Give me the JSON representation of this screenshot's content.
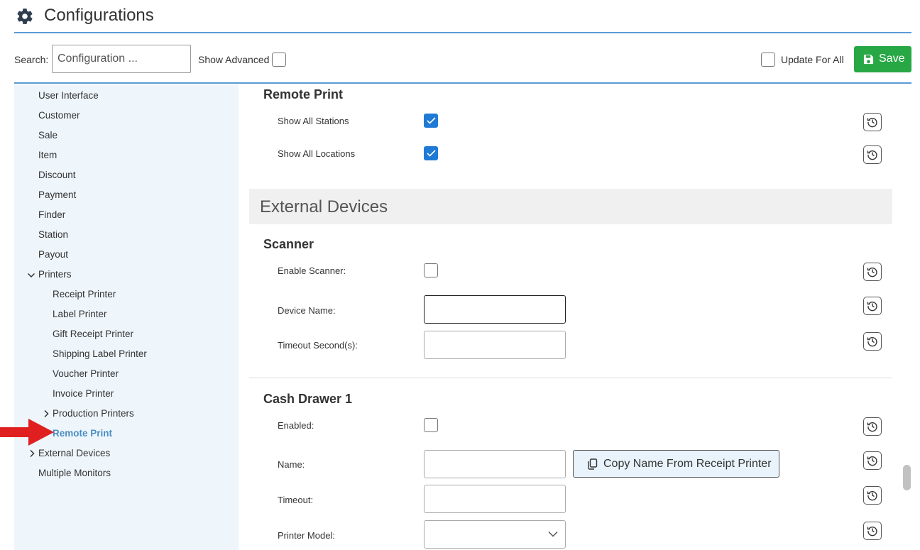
{
  "header": {
    "title": "Configurations",
    "icon": "gear-icon"
  },
  "toolbar": {
    "search_label": "Search:",
    "search_placeholder": "Configuration ...",
    "show_advanced_label": "Show Advanced",
    "update_for_all_label": "Update For All",
    "save_label": "Save"
  },
  "sidebar": {
    "items": [
      {
        "label": "User Interface"
      },
      {
        "label": "Customer"
      },
      {
        "label": "Sale"
      },
      {
        "label": "Item"
      },
      {
        "label": "Discount"
      },
      {
        "label": "Payment"
      },
      {
        "label": "Finder"
      },
      {
        "label": "Station"
      },
      {
        "label": "Payout"
      },
      {
        "label": "Printers"
      },
      {
        "label": "Receipt Printer"
      },
      {
        "label": "Label Printer"
      },
      {
        "label": "Gift Receipt Printer"
      },
      {
        "label": "Shipping Label Printer"
      },
      {
        "label": "Voucher Printer"
      },
      {
        "label": "Invoice Printer"
      },
      {
        "label": "Production Printers"
      },
      {
        "label": "Remote Print"
      },
      {
        "label": "External Devices"
      },
      {
        "label": "Multiple Monitors"
      }
    ]
  },
  "main": {
    "remote_print": {
      "title": "Remote Print",
      "show_all_stations": "Show All Stations",
      "show_all_locations": "Show All Locations"
    },
    "external_devices": {
      "title": "External Devices"
    },
    "scanner": {
      "title": "Scanner",
      "enable_scanner": "Enable Scanner:",
      "device_name": "Device Name:",
      "timeout_seconds": "Timeout Second(s):"
    },
    "cash_drawer": {
      "title": "Cash Drawer 1",
      "enabled": "Enabled:",
      "name": "Name:",
      "copy_button": "Copy Name From Receipt Printer",
      "timeout": "Timeout:",
      "printer_model": "Printer Model:"
    }
  },
  "colors": {
    "accent": "#5b9bd5",
    "save": "#28a745",
    "checkbox": "#1f7ad6",
    "sidebar_bg": "#eef5fb",
    "active_nav": "#4a8fc4",
    "arrow": "#e02020"
  }
}
